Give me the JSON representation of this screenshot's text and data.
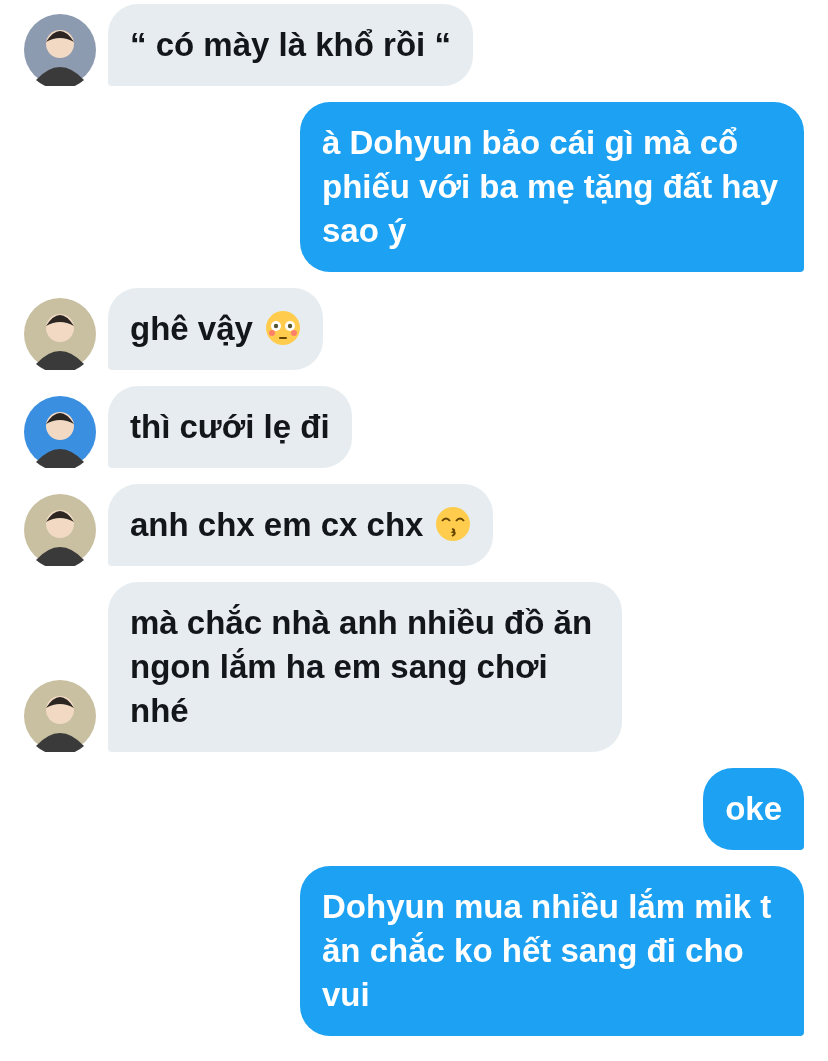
{
  "messages": [
    {
      "kind": "incoming",
      "text": "“ có mày là khổ rồi “",
      "color": "#8d9bb0"
    },
    {
      "kind": "outgoing",
      "text": "à Dohyun bảo cái gì mà cổ phiếu với ba mẹ tặng đất hay sao ý"
    },
    {
      "kind": "incoming",
      "text": "ghê vậy",
      "emoji": {
        "kind": "flushed"
      },
      "color": "#c9c0a2"
    },
    {
      "kind": "incoming",
      "text": "thì cưới lẹ đi",
      "color": "#3b8fe0"
    },
    {
      "kind": "incoming",
      "text": "anh chx em cx chx",
      "emoji": {
        "kind": "kissing"
      },
      "color": "#c9c0a2"
    },
    {
      "kind": "incoming",
      "text": "mà chắc nhà anh nhiều đồ ăn ngon lắm ha em sang chơi nhé",
      "color": "#c9c0a2"
    },
    {
      "kind": "outgoing",
      "text": "oke"
    },
    {
      "kind": "outgoing",
      "text": "Dohyun mua nhiều lắm mik t ăn chắc ko hết sang đi cho vui"
    }
  ]
}
